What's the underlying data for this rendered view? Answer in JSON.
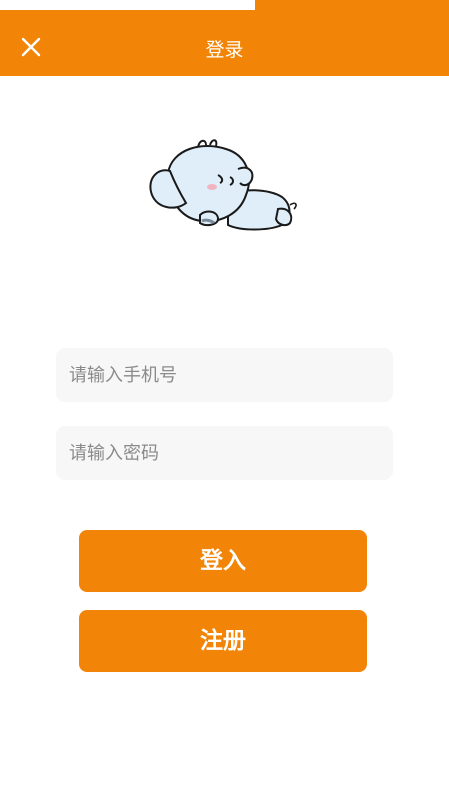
{
  "header": {
    "title": "登录",
    "close_icon": "close-icon",
    "color": "#f28507"
  },
  "mascot": {
    "icon": "sleeping-elephant-illustration"
  },
  "form": {
    "phone_placeholder": "请输入手机号",
    "password_placeholder": "请输入密码"
  },
  "buttons": {
    "login_label": "登入",
    "register_label": "注册",
    "color": "#f28507"
  }
}
